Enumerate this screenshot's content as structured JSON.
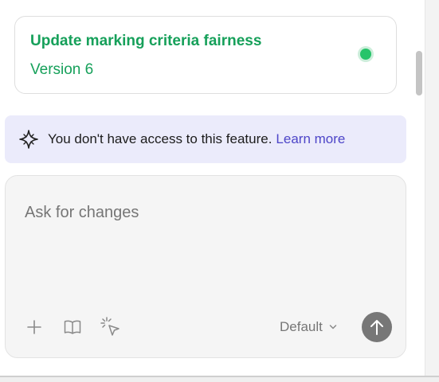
{
  "version_card": {
    "title": "Update marking criteria fairness",
    "version": "Version 6",
    "status_color": "#27c46a"
  },
  "access_banner": {
    "icon": "sparkle-icon",
    "message": "You don't have access to this feature.",
    "link": "Learn more"
  },
  "composer": {
    "placeholder": "Ask for changes",
    "tools": [
      "plus-icon",
      "book-icon",
      "cursor-click-icon"
    ],
    "model": "Default",
    "send_icon": "arrow-up-icon"
  },
  "colors": {
    "accent_green": "#16a05a",
    "link_purple": "#4d45c8",
    "banner_bg": "#ebebfb"
  }
}
